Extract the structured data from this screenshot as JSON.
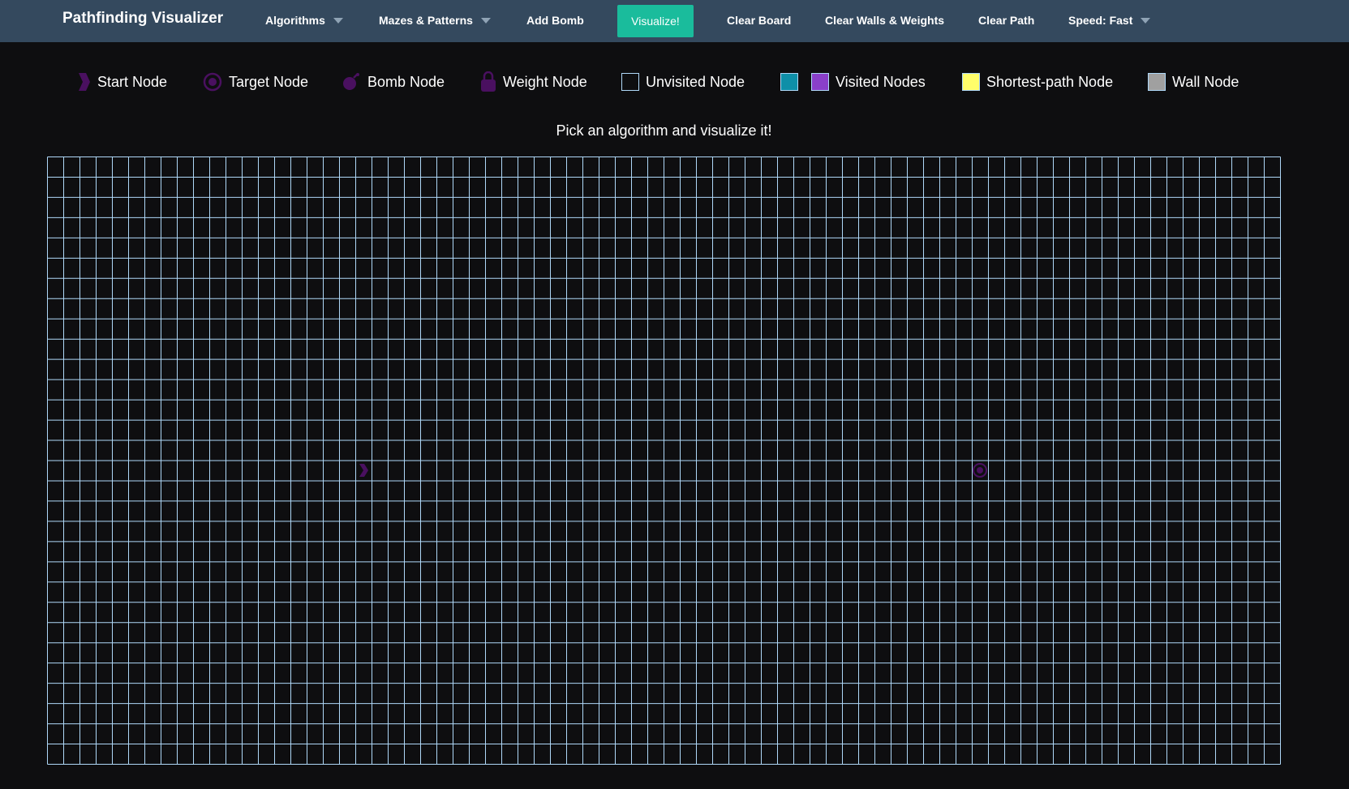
{
  "navbar": {
    "brand": "Pathfinding Visualizer",
    "algorithms_label": "Algorithms",
    "mazes_label": "Mazes & Patterns",
    "add_bomb_label": "Add Bomb",
    "visualize_label": "Visualize!",
    "clear_board_label": "Clear Board",
    "clear_walls_label": "Clear Walls & Weights",
    "clear_path_label": "Clear Path",
    "speed_label": "Speed: Fast"
  },
  "legend": {
    "start": "Start Node",
    "target": "Target Node",
    "bomb": "Bomb Node",
    "weight": "Weight Node",
    "unvisited": "Unvisited Node",
    "visited": "Visited Nodes",
    "shortest": "Shortest-path Node",
    "wall": "Wall Node"
  },
  "headline": "Pick an algorithm and visualize it!",
  "grid": {
    "rows": 30,
    "cols": 76,
    "start_node": {
      "row": 15,
      "col": 19
    },
    "target_node": {
      "row": 15,
      "col": 57
    }
  },
  "colors": {
    "navbar": "#34495e",
    "background": "#0e0e10",
    "grid_line": "#afd8f8",
    "accent": "#1abc9c",
    "node_icon": "#4a1060",
    "visited_teal": "#0e8fa8",
    "visited_purple": "#8a3fc9",
    "shortest_path": "#fffe6a",
    "wall": "#a0a0a0"
  },
  "icons": {
    "start": "chevron-right-icon",
    "target": "target-circle-icon",
    "bomb": "bomb-icon",
    "weight": "weight-icon"
  }
}
